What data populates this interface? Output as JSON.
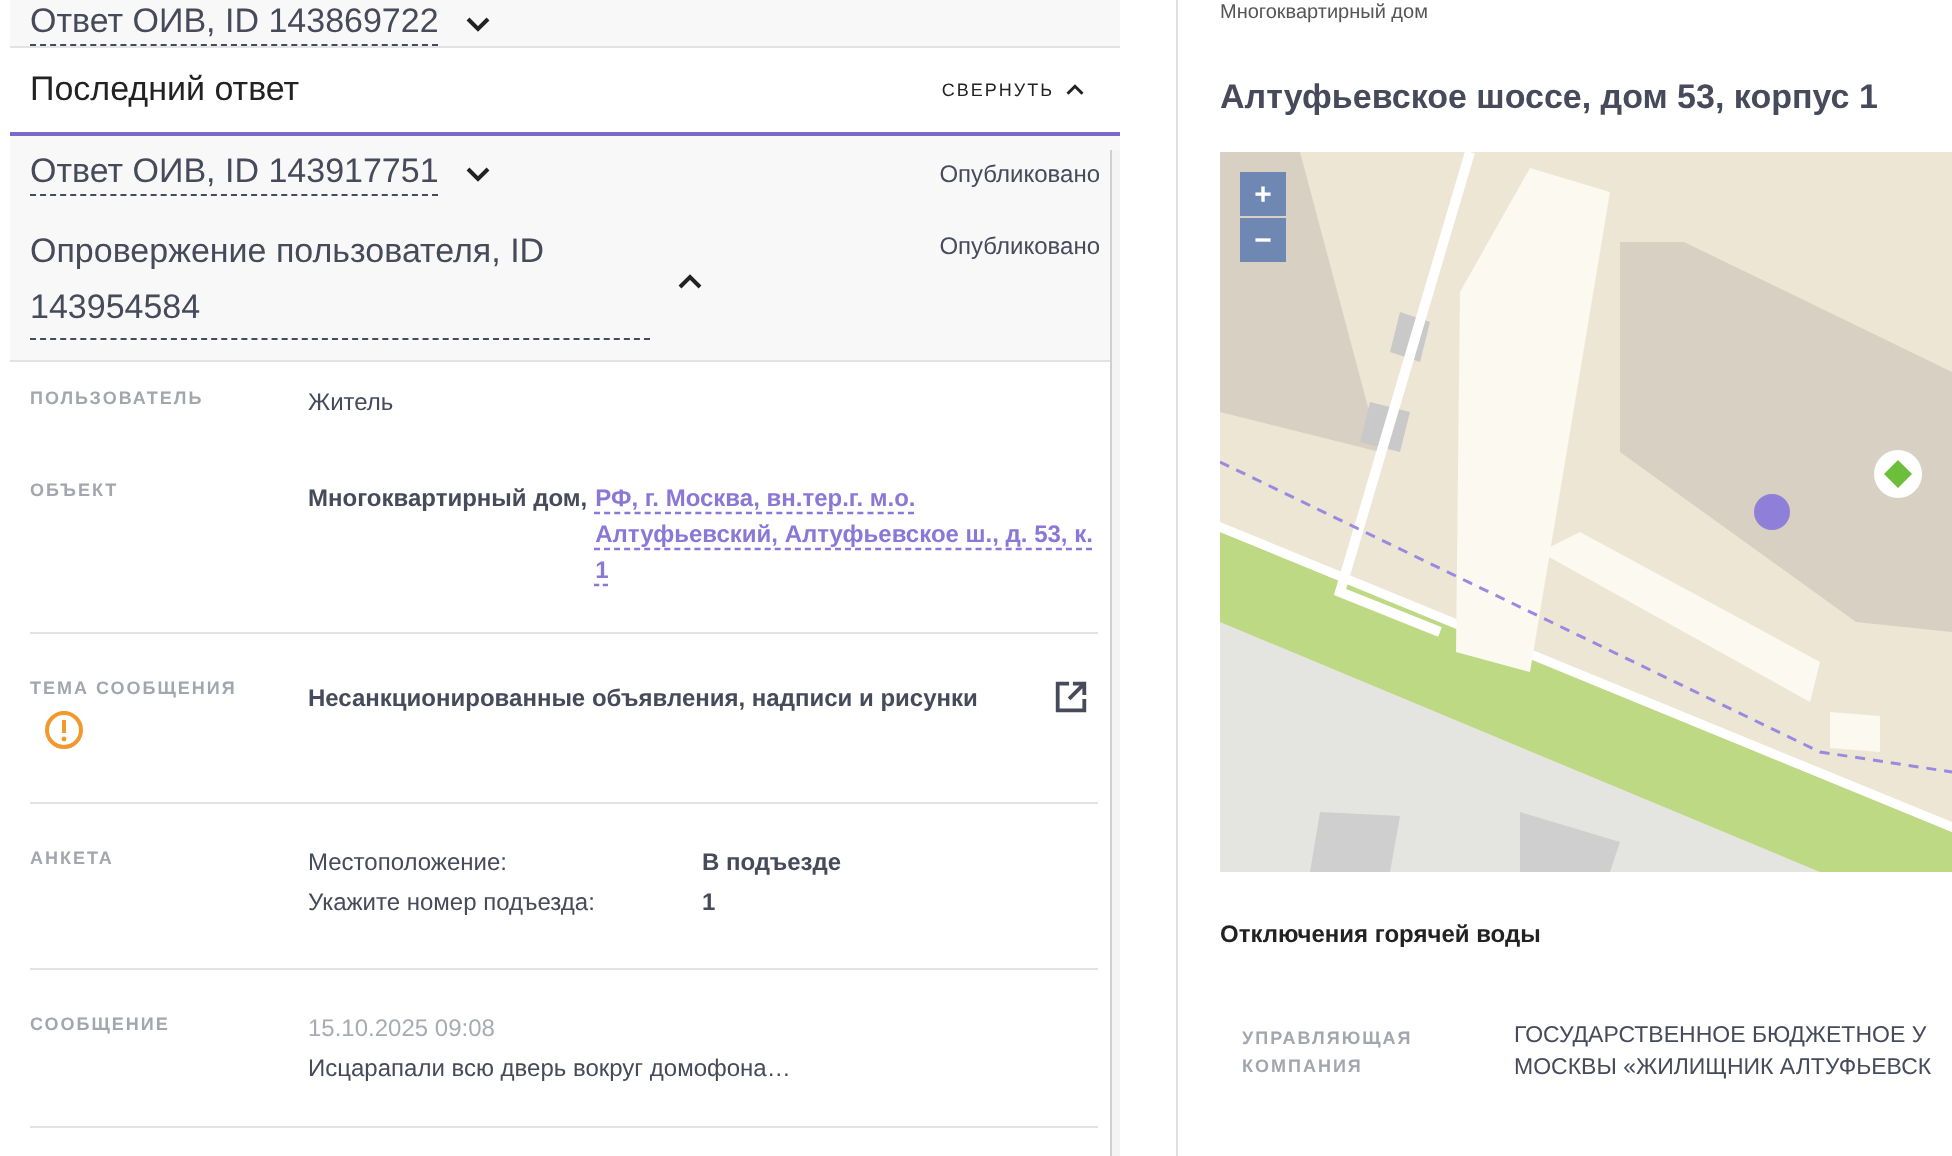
{
  "left": {
    "previous_item": {
      "title": "Ответ ОИВ, ID 143869722",
      "expanded": false
    },
    "section": {
      "title": "Последний ответ",
      "toggle": "СВЕРНУТЬ",
      "expanded": true
    },
    "responses": [
      {
        "title": "Ответ ОИВ, ID 143917751",
        "status": "Опубликовано",
        "expanded": false
      },
      {
        "title": "Опровержение пользователя, ID 143954584",
        "status": "Опубликовано",
        "expanded": true
      }
    ],
    "details": [
      {
        "kind": "text",
        "label": "ПОЛЬЗОВАТЕЛЬ",
        "value": "Житель"
      },
      {
        "kind": "object",
        "label": "ОБЪЕКТ",
        "object_type": "Многоквартирный дом,",
        "address": "РФ, г. Москва, вн.тер.г. м.о. Алтуфьевский, Алтуфьевское ш., д. 53, к. 1"
      },
      {
        "kind": "topic",
        "label": "ТЕМА СООБЩЕНИЯ",
        "warning": true,
        "value": "Несанкционированные объявления, надписи и рисунки"
      },
      {
        "kind": "survey",
        "label": "АНКЕТА",
        "answers": [
          {
            "question": "Местоположение:",
            "answer": "В подъезде"
          },
          {
            "question": "Укажите номер подъезда:",
            "answer": "1"
          }
        ]
      },
      {
        "kind": "message",
        "label": "СООБЩЕНИЕ",
        "time": "15.10.2025 09:08",
        "text": "Исцарапали всю дверь вокруг домофона…"
      }
    ]
  },
  "right": {
    "object_type": "Многоквартирный дом",
    "title": "Алтуфьевское шоссе, дом 53, корпус 1",
    "map": {
      "zoom_in": "+",
      "zoom_out": "−"
    },
    "section_title": "Отключения горячей воды",
    "company": {
      "label": "УПРАВЛЯЮЩАЯ КОМПАНИЯ",
      "lines": [
        "ГОСУДАРСТВЕННОЕ БЮДЖЕТНОЕ У",
        "МОСКВЫ «ЖИЛИЩНИК АЛТУФЬЕВСК"
      ]
    }
  }
}
